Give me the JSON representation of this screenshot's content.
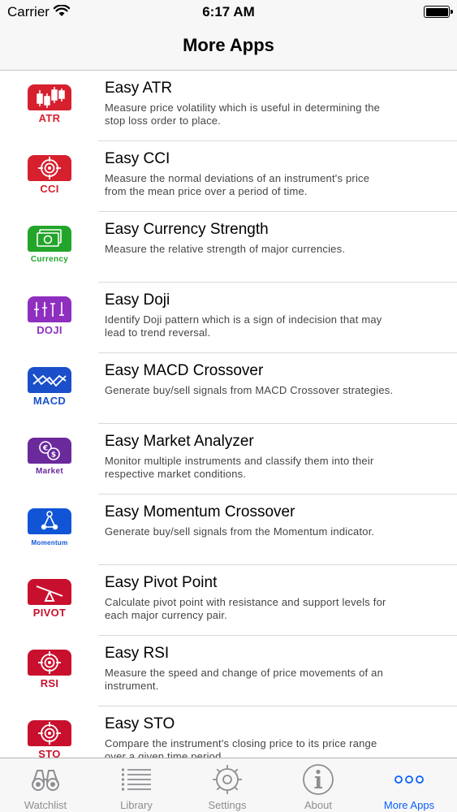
{
  "status_bar": {
    "carrier": "Carrier",
    "time": "6:17 AM"
  },
  "nav": {
    "title": "More Apps"
  },
  "apps": [
    {
      "icon_label": "ATR",
      "icon_color": "#d6202e",
      "title": "Easy ATR",
      "desc_line1": "Measure price volatility which is useful in determining the",
      "desc_line2": "stop loss order to place."
    },
    {
      "icon_label": "CCI",
      "icon_color": "#d6202e",
      "title": "Easy CCI",
      "desc_line1": "Measure the normal deviations of an instrument's price",
      "desc_line2": "from the mean price over a period of time."
    },
    {
      "icon_label": "Currency",
      "icon_color": "#23a52b",
      "title": "Easy Currency Strength",
      "desc_line1": "Measure the relative strength of major currencies.",
      "desc_line2": ""
    },
    {
      "icon_label": "DOJI",
      "icon_color": "#8e2fbf",
      "title": "Easy Doji",
      "desc_line1": "Identify Doji pattern which is a sign of indecision that may",
      "desc_line2": "lead to trend reversal."
    },
    {
      "icon_label": "MACD",
      "icon_color": "#1a4fc9",
      "title": "Easy MACD Crossover",
      "desc_line1": "Generate buy/sell signals from MACD Crossover strategies.",
      "desc_line2": ""
    },
    {
      "icon_label": "Market",
      "icon_color": "#6b2a9c",
      "title": "Easy Market Analyzer",
      "desc_line1": "Monitor multiple instruments and classify them into their",
      "desc_line2": "respective market conditions."
    },
    {
      "icon_label": "Momentum",
      "icon_color": "#1155d6",
      "title": "Easy Momentum Crossover",
      "desc_line1": "Generate buy/sell signals from the Momentum indicator.",
      "desc_line2": ""
    },
    {
      "icon_label": "PIVOT",
      "icon_color": "#c8102e",
      "title": "Easy Pivot Point",
      "desc_line1": "Calculate pivot point with resistance and support levels for",
      "desc_line2": "each major currency pair."
    },
    {
      "icon_label": "RSI",
      "icon_color": "#c8102e",
      "title": "Easy RSI",
      "desc_line1": "Measure the speed and change of price movements of an",
      "desc_line2": "instrument."
    },
    {
      "icon_label": "STO",
      "icon_color": "#c8102e",
      "title": "Easy STO",
      "desc_line1": "Compare the instrument's closing price to its price range",
      "desc_line2": "over a given time period."
    }
  ],
  "tabs": [
    {
      "label": "Watchlist",
      "icon": "binoculars-icon"
    },
    {
      "label": "Library",
      "icon": "list-icon"
    },
    {
      "label": "Settings",
      "icon": "gear-icon"
    },
    {
      "label": "About",
      "icon": "info-icon"
    },
    {
      "label": "More Apps",
      "icon": "more-dots-icon",
      "active": true
    }
  ],
  "colors": {
    "accent": "#0a60ff",
    "inactive": "#8e8e93"
  }
}
